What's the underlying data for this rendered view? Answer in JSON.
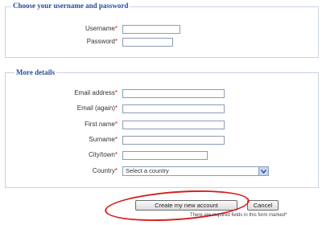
{
  "account_section": {
    "legend": "Choose your username and password",
    "fields": [
      {
        "label": "Username",
        "required_mark": "*",
        "value": ""
      },
      {
        "label": "Password",
        "required_mark": "*",
        "value": ""
      }
    ]
  },
  "details_section": {
    "legend": "More details",
    "fields": [
      {
        "label": "Email address",
        "required_mark": "*",
        "value": ""
      },
      {
        "label": "Email (again)",
        "required_mark": "*",
        "value": ""
      },
      {
        "label": "First name",
        "required_mark": "*",
        "value": ""
      },
      {
        "label": "Surname",
        "required_mark": "*",
        "value": ""
      },
      {
        "label": "City/town",
        "required_mark": "*",
        "value": ""
      },
      {
        "label": "Country",
        "required_mark": "*",
        "selected": "Select a country"
      }
    ]
  },
  "buttons": {
    "create": "Create my new account",
    "cancel": "Cancel"
  },
  "footer_note": "There are required fields in this form marked*",
  "colors": {
    "accent": "#2a4aa0",
    "required": "#e01010",
    "highlight": "#d81e1e"
  }
}
